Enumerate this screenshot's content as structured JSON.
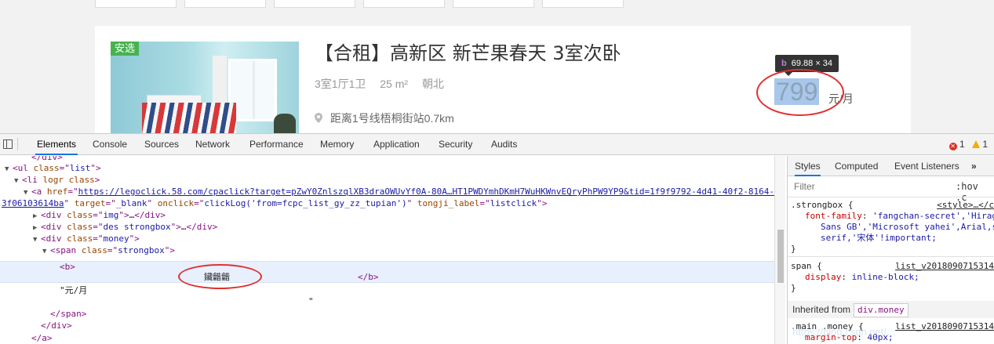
{
  "listing": {
    "badge": "安选",
    "title": "【合租】高新区 新芒果春天 3室次卧",
    "layout": "3室1厅1卫",
    "area": "25 m²",
    "orientation": "朝北",
    "distance": "距离1号线梧桐街站0.7km",
    "price": "799",
    "price_unit": "元/月",
    "tooltip_tag": "b",
    "tooltip_size": "69.88 × 34"
  },
  "devtools": {
    "tabs": [
      "Elements",
      "Console",
      "Sources",
      "Network",
      "Performance",
      "Memory",
      "Application",
      "Security",
      "Audits"
    ],
    "active_tab": "Elements",
    "issues": {
      "errors": "1",
      "warnings": "1"
    },
    "dom": {
      "l0": "</div>",
      "ul_tag": "ul",
      "ul_class": "list",
      "li_tag": "li",
      "li_attr": "logr",
      "li_attr2": "class",
      "a_href": "https://legoclick.58.com/cpaclick?target=pZwY0ZnlszqlXB3draOWUvYf0A-80A…HT1PWDYmhDKmH7WuHKWnvEQryPhPW9YP9&tid=1f9f9792-4d41-40f2-8164-",
      "a_href_cont": "3f06103614ba",
      "a_target": "_blank",
      "a_onclick": "clickLog('from=fcpc_list_gy_zz_tupian')",
      "a_tongji": "listclick",
      "div_img_class": "img",
      "div_des_class": "des strongbox",
      "div_money_class": "money",
      "span_class": "strongbox",
      "b_open": "<b>",
      "b_text": "鑶龤龤",
      "b_close": "</b>",
      "yuan_text": "\"元/月",
      "quote_close": "\"",
      "span_close": "</span>",
      "div_close": "</div>",
      "a_close": "</a>"
    },
    "styles": {
      "tabs": [
        "Styles",
        "Computed",
        "Event Listeners"
      ],
      "more": "»",
      "filter_placeholder": "Filter",
      "hov": ":hov",
      "cls": ".c",
      "rule1_selector": ".strongbox {",
      "rule1_source": "<style>…</c",
      "rule1_prop": "font-family",
      "rule1_val1": "'fangchan-secret','Hirag",
      "rule1_val2": "Sans GB','Microsoft yahei',Arial,s",
      "rule1_val3": "serif,'宋体'!important;",
      "rule2_selector": "span {",
      "rule2_source": "list_v2018090715314",
      "rule2_prop": "display",
      "rule2_val": "inline-block;",
      "close_brace": "}",
      "inherited_label": "Inherited from",
      "inherited_from": "div.money",
      "rule3_selector": ".main .money {",
      "rule3_source": "list_v2018090715314",
      "rule3_prop": "margin-top",
      "rule3_val": "40px;"
    },
    "watermark": "https://blog.csdn.net/..."
  },
  "colors": {
    "badge": "#47b34f",
    "circle": "#e03131",
    "highlight": "#a8c7ea",
    "active_tab": "#1a73e8"
  }
}
